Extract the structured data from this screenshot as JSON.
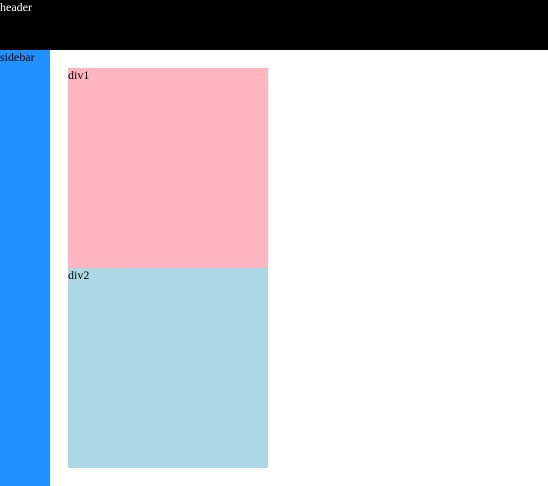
{
  "header": {
    "label": "header",
    "color": "#000000",
    "text_color": "#ffffff"
  },
  "sidebar": {
    "label": "sidebar",
    "color": "#1e90ff"
  },
  "main": {
    "div1": {
      "label": "div1",
      "color": "#ffb6c1"
    },
    "div2": {
      "label": "div2",
      "color": "#add8e6"
    }
  }
}
